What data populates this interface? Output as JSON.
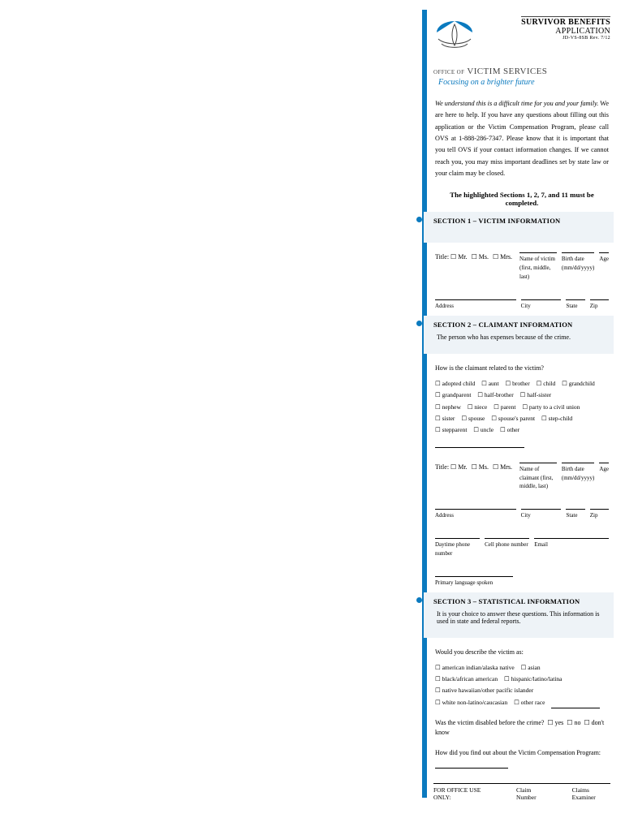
{
  "header": {
    "survivor": "SURVIVOR BENEFITS",
    "application": "APPLICATION",
    "formno": "JD-VS-8SB Rev. 7/12",
    "office_prefix": "OFFICE OF",
    "office_name": "VICTIM SERVICES",
    "tagline": "Focusing on a brighter future"
  },
  "intro": {
    "lead": "We understand this is a difficult time for you and your family.",
    "body": " We are here to help. If you have any questions about filling out this application or the Victim Compensation Program, please call OVS at 1-888-286-7347. Please know that it is important that you tell OVS if your contact information changes. If we cannot reach you, you may miss important deadlines set by state law or your claim may be closed."
  },
  "must": "The highlighted Sections 1, 2, 7, and 11 must be completed.",
  "sections": {
    "s1": {
      "title": "SECTION 1 – VICTIM INFORMATION",
      "title_prefix": "Title:",
      "mr": "☐ Mr.",
      "ms": "☐ Ms.",
      "mrs": "☐ Mrs.",
      "name_lbl": "Name of victim (first, middle, last)",
      "birth_lbl": "Birth date (mm/dd/yyyy)",
      "age_lbl": "Age",
      "addr": "Address",
      "city": "City",
      "state": "State",
      "zip": "Zip"
    },
    "s2": {
      "title": "SECTION 2 – CLAIMANT INFORMATION",
      "note": "The person who has expenses because of the crime.",
      "rel_q": "How is the claimant related to the victim?",
      "rel": [
        "☐ adopted child",
        "☐ aunt",
        "☐ brother",
        "☐ child",
        "☐ grandchild",
        "☐ grandparent",
        "☐ half-brother",
        "☐ half-sister",
        "☐ nephew",
        "☐ niece",
        "☐ parent",
        "☐ party to a civil union",
        "☐ sister",
        "☐ spouse",
        "☐ spouse's parent",
        "☐ step-child",
        "☐ stepparent",
        "☐ uncle",
        "☐ other"
      ],
      "title_prefix": "Title:",
      "mr": "☐ Mr.",
      "ms": "☐ Ms.",
      "mrs": "☐ Mrs.",
      "name_lbl": "Name of claimant (first, middle, last)",
      "birth_lbl": "Birth date (mm/dd/yyyy)",
      "age_lbl": "Age",
      "addr": "Address",
      "city": "City",
      "state": "State",
      "zip": "Zip",
      "dayphone": "Daytime phone number",
      "cellphone": "Cell phone number",
      "email": "Email",
      "lang": "Primary language spoken"
    },
    "s3": {
      "title": "SECTION 3 – STATISTICAL INFORMATION",
      "note": "It is your choice to answer these questions. This information is used in state and federal reports.",
      "race_q": "Would you describe the victim as:",
      "race": [
        "☐ american indian/alaska native",
        "☐ asian",
        "☐ black/african american",
        "☐ hispanic/latino/latina",
        "☐ native hawaiian/other pacific islander",
        "☐ white non-latino/caucasian",
        "☐ other race"
      ],
      "disabled_q": "Was the victim disabled before the crime?",
      "disabled_opts": [
        "☐ yes",
        "☐ no",
        "☐ don't know"
      ],
      "findout_q": "How did you find out about the Victim Compensation Program:"
    }
  },
  "footer": {
    "office": "FOR OFFICE USE ONLY:",
    "claimno": "Claim Number",
    "examiner": "Claims Examiner"
  }
}
